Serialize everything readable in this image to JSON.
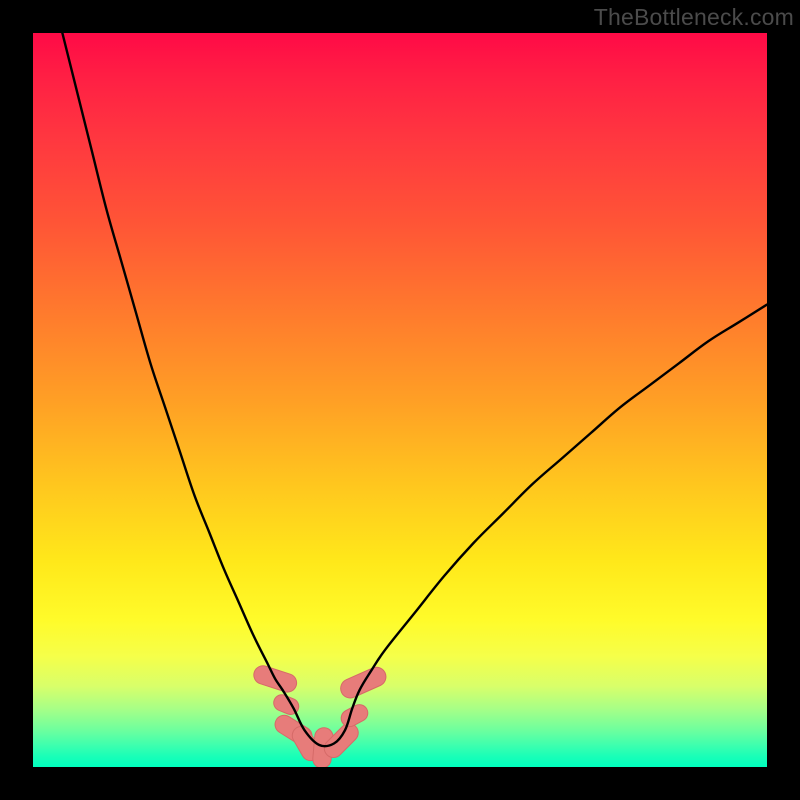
{
  "watermark": "TheBottleneck.com",
  "colors": {
    "frame": "#000000",
    "curve_stroke": "#000000",
    "bead_fill": "#e77c7a",
    "bead_stroke": "#d66a68"
  },
  "chart_data": {
    "type": "line",
    "title": "",
    "xlabel": "",
    "ylabel": "",
    "xlim": [
      0,
      100
    ],
    "ylim": [
      0,
      100
    ],
    "note": "Axes are unlabeled; values are normalized 0-100 estimates read from pixel positions (0 = bottom-left). y appears to represent a bottleneck/mismatch percentage minimized near x≈38.",
    "series": [
      {
        "name": "bottleneck-curve",
        "x": [
          4,
          6,
          8,
          10,
          12,
          14,
          16,
          18,
          20,
          22,
          24,
          26,
          28,
          30,
          32,
          33,
          34,
          35.5,
          37,
          39,
          41,
          42.5,
          43.5,
          44.5,
          46,
          48,
          52,
          56,
          60,
          64,
          68,
          72,
          76,
          80,
          84,
          88,
          92,
          96,
          100
        ],
        "y": [
          100,
          92,
          84,
          76,
          69,
          62,
          55,
          49,
          43,
          37,
          32,
          27,
          22.5,
          18,
          14,
          12,
          10.5,
          8,
          5,
          3,
          3.2,
          5,
          8,
          10.5,
          13,
          16,
          21,
          26,
          30.5,
          34.5,
          38.5,
          42,
          45.5,
          49,
          52,
          55,
          58,
          60.5,
          63
        ]
      }
    ],
    "annotations": {
      "beads": [
        {
          "x": 33,
          "y": 12,
          "w": 2.5,
          "h": 6,
          "angle": -72
        },
        {
          "x": 34.5,
          "y": 8.5,
          "w": 2.2,
          "h": 3.5,
          "angle": -68
        },
        {
          "x": 35.5,
          "y": 5.0,
          "w": 2.5,
          "h": 5.5,
          "angle": -58
        },
        {
          "x": 37.2,
          "y": 3.2,
          "w": 2.5,
          "h": 5.0,
          "angle": -30
        },
        {
          "x": 39.5,
          "y": 2.6,
          "w": 2.5,
          "h": 5.5,
          "angle": 5
        },
        {
          "x": 42.0,
          "y": 3.6,
          "w": 2.5,
          "h": 5.5,
          "angle": 45
        },
        {
          "x": 43.8,
          "y": 7.0,
          "w": 2.3,
          "h": 3.8,
          "angle": 62
        },
        {
          "x": 45.0,
          "y": 11.5,
          "w": 2.6,
          "h": 6.5,
          "angle": 66
        }
      ]
    }
  }
}
